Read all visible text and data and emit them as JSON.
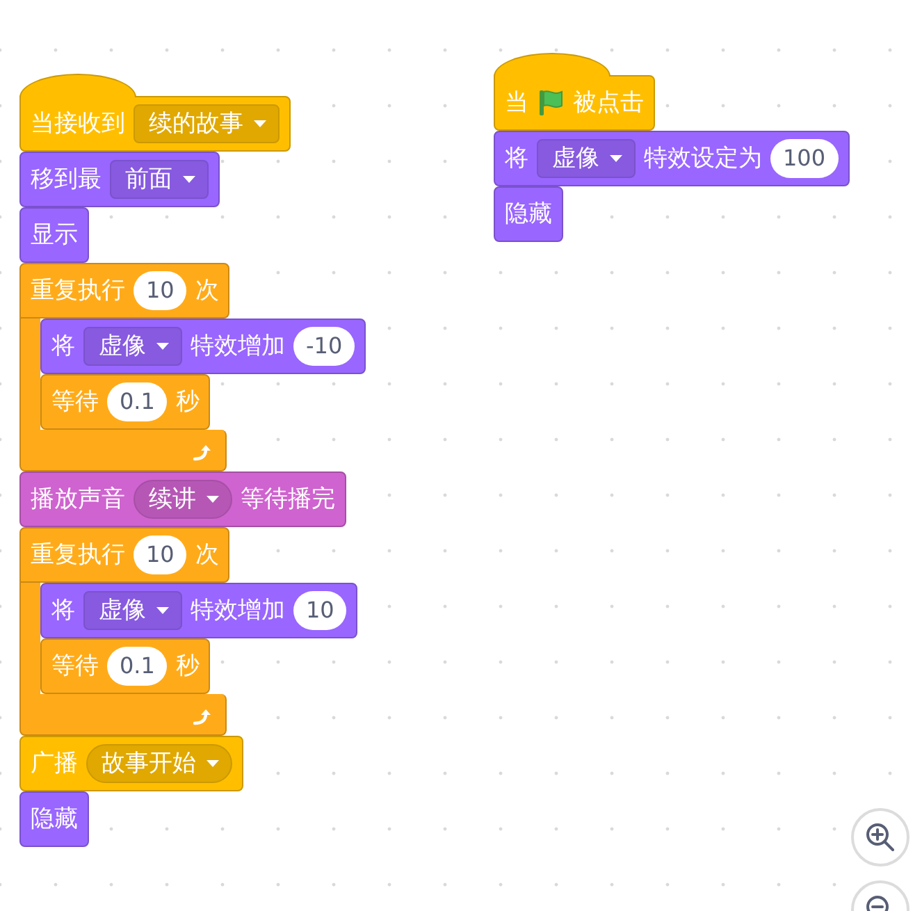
{
  "scripts": [
    {
      "blocks": [
        {
          "kind": "hat",
          "color": "#ffbf00",
          "parts": [
            {
              "kind": "label",
              "text": "当接收到"
            },
            {
              "kind": "menu",
              "text": "续的故事"
            }
          ]
        },
        {
          "kind": "stack",
          "color": "#9966ff",
          "parts": [
            {
              "kind": "label",
              "text": "移到最"
            },
            {
              "kind": "menu",
              "text": "前面"
            }
          ]
        },
        {
          "kind": "stack",
          "color": "#9966ff",
          "parts": [
            {
              "kind": "label",
              "text": "显示"
            }
          ]
        },
        {
          "kind": "loop",
          "color": "#ffab19",
          "parts": [
            {
              "kind": "label",
              "text": "重复执行"
            },
            {
              "kind": "number",
              "text": "10"
            },
            {
              "kind": "label",
              "text": "次"
            }
          ],
          "children": [
            {
              "kind": "stack",
              "color": "#9966ff",
              "parts": [
                {
                  "kind": "label",
                  "text": "将"
                },
                {
                  "kind": "menu",
                  "text": "虚像"
                },
                {
                  "kind": "label",
                  "text": "特效增加"
                },
                {
                  "kind": "number",
                  "text": "-10"
                }
              ]
            },
            {
              "kind": "stack",
              "color": "#ffab19",
              "parts": [
                {
                  "kind": "label",
                  "text": "等待"
                },
                {
                  "kind": "number",
                  "text": "0.1"
                },
                {
                  "kind": "label",
                  "text": "秒"
                }
              ]
            }
          ]
        },
        {
          "kind": "stack",
          "color": "#cf63cf",
          "parts": [
            {
              "kind": "label",
              "text": "播放声音"
            },
            {
              "kind": "round-menu",
              "text": "续讲"
            },
            {
              "kind": "label",
              "text": "等待播完"
            }
          ]
        },
        {
          "kind": "loop",
          "color": "#ffab19",
          "parts": [
            {
              "kind": "label",
              "text": "重复执行"
            },
            {
              "kind": "number",
              "text": "10"
            },
            {
              "kind": "label",
              "text": "次"
            }
          ],
          "children": [
            {
              "kind": "stack",
              "color": "#9966ff",
              "parts": [
                {
                  "kind": "label",
                  "text": "将"
                },
                {
                  "kind": "menu",
                  "text": "虚像"
                },
                {
                  "kind": "label",
                  "text": "特效增加"
                },
                {
                  "kind": "number",
                  "text": "10"
                }
              ]
            },
            {
              "kind": "stack",
              "color": "#ffab19",
              "parts": [
                {
                  "kind": "label",
                  "text": "等待"
                },
                {
                  "kind": "number",
                  "text": "0.1"
                },
                {
                  "kind": "label",
                  "text": "秒"
                }
              ]
            }
          ]
        },
        {
          "kind": "stack",
          "color": "#ffbf00",
          "parts": [
            {
              "kind": "label",
              "text": "广播"
            },
            {
              "kind": "round-menu",
              "text": "故事开始"
            }
          ]
        },
        {
          "kind": "stack",
          "color": "#9966ff",
          "parts": [
            {
              "kind": "label",
              "text": "隐藏"
            }
          ]
        }
      ]
    },
    {
      "blocks": [
        {
          "kind": "hat",
          "color": "#ffbf00",
          "parts": [
            {
              "kind": "label",
              "text": "当"
            },
            {
              "kind": "flag"
            },
            {
              "kind": "label",
              "text": "被点击"
            }
          ]
        },
        {
          "kind": "stack",
          "color": "#9966ff",
          "parts": [
            {
              "kind": "label",
              "text": "将"
            },
            {
              "kind": "menu",
              "text": "虚像"
            },
            {
              "kind": "label",
              "text": "特效设定为"
            },
            {
              "kind": "number",
              "text": "100"
            }
          ]
        },
        {
          "kind": "stack",
          "color": "#9966ff",
          "parts": [
            {
              "kind": "label",
              "text": "隐藏"
            }
          ]
        }
      ]
    }
  ]
}
